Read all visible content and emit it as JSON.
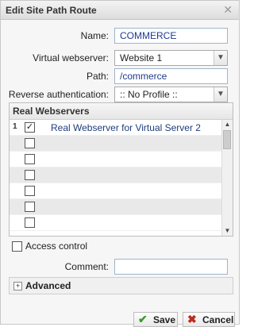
{
  "dialog": {
    "title": "Edit Site Path Route",
    "close_glyph": "✕"
  },
  "form": {
    "name_label": "Name:",
    "name_value": "COMMERCE",
    "vws_label": "Virtual webserver:",
    "vws_value": "Website 1",
    "path_label": "Path:",
    "path_value": "/commerce",
    "reverse_auth_label": "Reverse authentication:",
    "reverse_auth_value": ":: No Profile ::"
  },
  "real_webservers": {
    "header": "Real Webservers",
    "rows": [
      {
        "num": "1",
        "checked": true,
        "label": "Real Webserver for Virtual Server 2"
      },
      {
        "num": "",
        "checked": false,
        "label": ""
      },
      {
        "num": "",
        "checked": false,
        "label": ""
      },
      {
        "num": "",
        "checked": false,
        "label": ""
      },
      {
        "num": "",
        "checked": false,
        "label": ""
      },
      {
        "num": "",
        "checked": false,
        "label": ""
      },
      {
        "num": "",
        "checked": false,
        "label": ""
      },
      {
        "num": "",
        "checked": false,
        "label": ""
      }
    ]
  },
  "access_control": {
    "label": "Access control",
    "checked": false
  },
  "comment": {
    "label": "Comment:",
    "value": ""
  },
  "advanced": {
    "label": "Advanced",
    "toggle_glyph": "+"
  },
  "buttons": {
    "save_label": "Save",
    "cancel_label": "Cancel"
  },
  "icons": {
    "close": "close-icon",
    "dropdown": "chevron-down-icon",
    "expand": "plus-icon",
    "save": "checkmark-icon",
    "cancel": "x-icon"
  },
  "colors": {
    "field_text": "#1f3b8f",
    "save_icon": "#3a9a2b",
    "cancel_icon": "#c0281c"
  }
}
